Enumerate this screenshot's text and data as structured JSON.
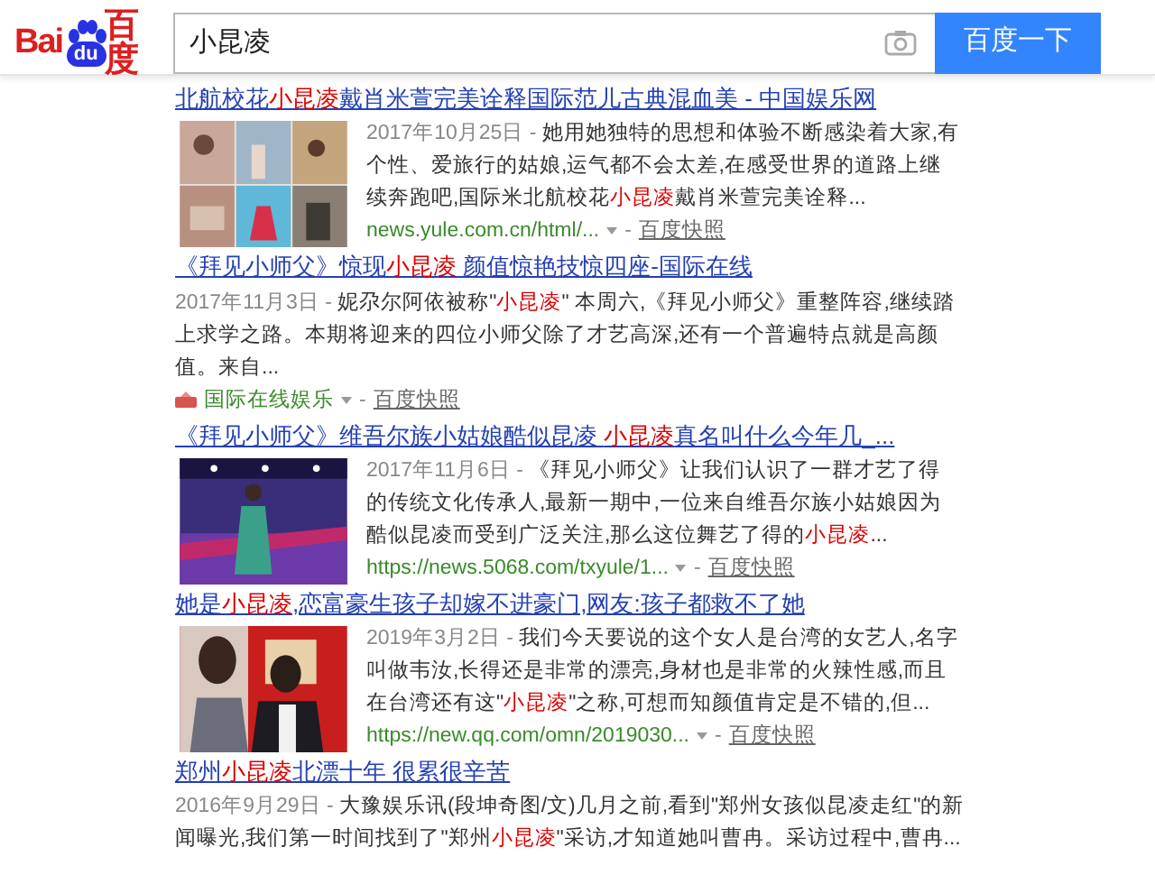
{
  "logo": {
    "left": "Bai",
    "paw": "du",
    "right": "百度"
  },
  "search": {
    "value": "小昆凌",
    "button": "百度一下"
  },
  "results": [
    {
      "kind": "picture",
      "title": [
        {
          "text": "北航校花",
          "highlight": false
        },
        {
          "text": "小昆凌",
          "highlight": true
        },
        {
          "text": "戴肖米萱完美诠释国际范儿古典混血美 - 中国娱乐网",
          "highlight": false
        }
      ],
      "date": "2017年10月25日 -",
      "snippet": [
        {
          "text": "她用她独特的思想和体验不断感染着大家,有个性、爱旅行的姑娘,运气都不会太差,在感受世界的道路上继续奔跑吧,国际米北航校花",
          "highlight": false
        },
        {
          "text": "小昆凌",
          "highlight": true
        },
        {
          "text": "戴肖米萱完美诠释...",
          "highlight": false
        }
      ],
      "source": "news.yule.com.cn/html/...",
      "sep": "-",
      "snapshot": "百度快照"
    },
    {
      "kind": "text",
      "title": [
        {
          "text": "《拜见小师父》惊现",
          "highlight": false
        },
        {
          "text": "小昆凌",
          "highlight": true
        },
        {
          "text": " 颜值惊艳技惊四座-国际在线",
          "highlight": false
        }
      ],
      "date": "2017年11月3日 -",
      "snippet": [
        {
          "text": "妮尕尔阿依被称\"",
          "highlight": false
        },
        {
          "text": "小昆凌",
          "highlight": true
        },
        {
          "text": "\" 本周六,《拜见小师父》重整阵容,继续踏上求学之路。本期将迎来的四位小师父除了才艺高深,还有一个普遍特点就是高颜值。来自...",
          "highlight": false
        }
      ],
      "source": "国际在线娱乐",
      "sep": "-",
      "snapshot": "百度快照"
    },
    {
      "kind": "picture",
      "title": [
        {
          "text": "《拜见小师父》维吾尔族小姑娘酷似昆凌 ",
          "highlight": false
        },
        {
          "text": "小昆凌",
          "highlight": true
        },
        {
          "text": "真名叫什么今年几_...",
          "highlight": false
        }
      ],
      "date": "2017年11月6日 -",
      "snippet": [
        {
          "text": "《拜见小师父》让我们认识了一群才艺了得的传统文化传承人,最新一期中,一位来自维吾尔族小姑娘因为酷似昆凌而受到广泛关注,那么这位舞艺了得的",
          "highlight": false
        },
        {
          "text": "小昆凌",
          "highlight": true
        },
        {
          "text": "...",
          "highlight": false
        }
      ],
      "source": "https://news.5068.com/txyule/1...",
      "sep": "-",
      "snapshot": "百度快照"
    },
    {
      "kind": "picture",
      "title": [
        {
          "text": "她是",
          "highlight": false
        },
        {
          "text": "小昆凌",
          "highlight": true
        },
        {
          "text": ",恋富豪生孩子却嫁不进豪门,网友:孩子都救不了她",
          "highlight": false
        }
      ],
      "date": "2019年3月2日 -",
      "snippet": [
        {
          "text": "我们今天要说的这个女人是台湾的女艺人,名字叫做韦汝,长得还是非常的漂亮,身材也是非常的火辣性感,而且在台湾还有这\"",
          "highlight": false
        },
        {
          "text": "小昆凌",
          "highlight": true
        },
        {
          "text": "\"之称,可想而知颜值肯定是不错的,但...",
          "highlight": false
        }
      ],
      "source": "https://new.qq.com/omn/2019030...",
      "sep": "-",
      "snapshot": "百度快照"
    },
    {
      "kind": "plain",
      "title": [
        {
          "text": "郑州",
          "highlight": false
        },
        {
          "text": "小昆凌",
          "highlight": true
        },
        {
          "text": "北漂十年 很累很辛苦",
          "highlight": false
        }
      ],
      "date": "2016年9月29日 -",
      "snippet": [
        {
          "text": "大豫娱乐讯(段坤奇图/文)几月之前,看到\"郑州女孩似昆凌走红\"的新闻曝光,我们第一时间找到了\"郑州",
          "highlight": false
        },
        {
          "text": "小昆凌",
          "highlight": true
        },
        {
          "text": "\"采访,才知道她叫曹冉。采访过程中,曹冉...",
          "highlight": false
        }
      ]
    }
  ]
}
